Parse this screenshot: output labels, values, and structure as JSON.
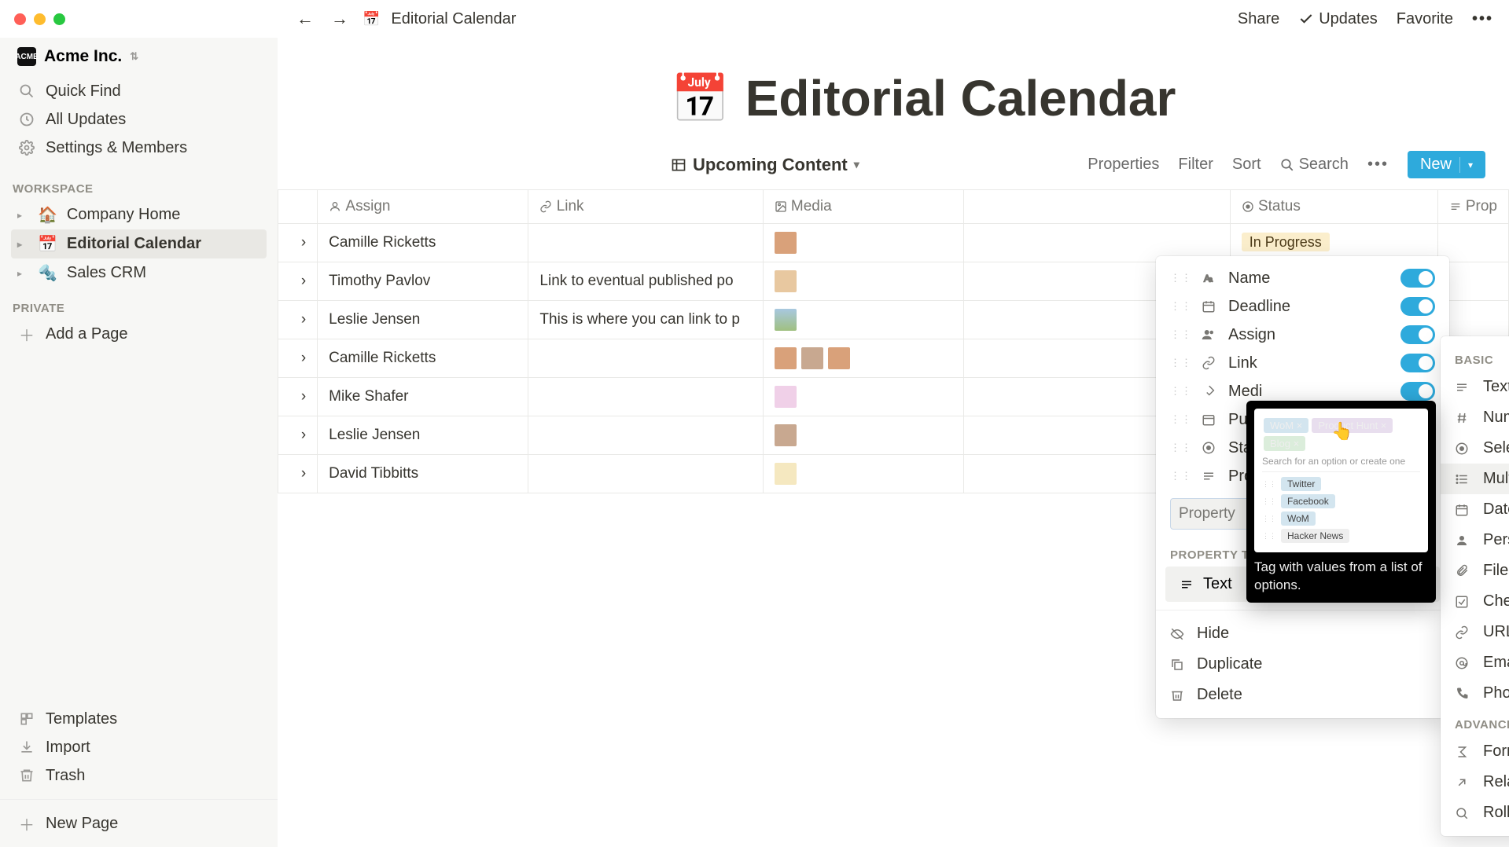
{
  "window": {
    "title": "Editorial Calendar"
  },
  "workspace": {
    "name": "Acme Inc."
  },
  "sidebar": {
    "quick_find": "Quick Find",
    "all_updates": "All Updates",
    "settings": "Settings & Members",
    "section_workspace": "WORKSPACE",
    "section_private": "PRIVATE",
    "items": [
      {
        "icon": "🏠",
        "label": "Company Home"
      },
      {
        "icon": "📅",
        "label": "Editorial Calendar"
      },
      {
        "icon": "🔩",
        "label": "Sales CRM"
      }
    ],
    "add_page": "Add a Page",
    "templates": "Templates",
    "import": "Import",
    "trash": "Trash",
    "new_page": "New Page"
  },
  "topbar": {
    "share": "Share",
    "updates": "Updates",
    "favorite": "Favorite"
  },
  "page": {
    "emoji": "📅",
    "title": "Editorial Calendar"
  },
  "database": {
    "view_name": "Upcoming Content",
    "actions": {
      "properties": "Properties",
      "filter": "Filter",
      "sort": "Sort",
      "search": "Search",
      "new": "New"
    },
    "columns": {
      "assign": "Assign",
      "link": "Link",
      "media": "Media",
      "status": "Status",
      "prop": "Prop"
    },
    "rows": [
      {
        "assign": "Camille Ricketts",
        "link": "",
        "media": 1,
        "status": "In Progress"
      },
      {
        "assign": "Timothy Pavlov",
        "link": "Link to eventual published po",
        "media": 1,
        "status": ""
      },
      {
        "assign": "Leslie Jensen",
        "link": "This is where you can link to p",
        "media": 1,
        "status": ""
      },
      {
        "assign": "Camille Ricketts",
        "link": "",
        "media": 3,
        "status": ""
      },
      {
        "assign": "Mike Shafer",
        "link": "",
        "media": 1,
        "status": ""
      },
      {
        "assign": "Leslie Jensen",
        "link": "",
        "media": 1,
        "status": ""
      },
      {
        "assign": "David Tibbitts",
        "link": "",
        "media": 1,
        "status": ""
      }
    ]
  },
  "properties_popover": {
    "items": [
      {
        "name": "Name"
      },
      {
        "name": "Deadline"
      },
      {
        "name": "Assign"
      },
      {
        "name": "Link"
      },
      {
        "name": "Medi"
      },
      {
        "name": "Publi"
      },
      {
        "name": "Statu"
      },
      {
        "name": "Prop"
      }
    ],
    "input_value": "Property",
    "section_type": "PROPERTY TYPE",
    "current_type": "Text",
    "hide": "Hide",
    "duplicate": "Duplicate",
    "delete": "Delete"
  },
  "tooltip": {
    "tags": [
      {
        "text": "WoM",
        "bg": "#d3e5ef"
      },
      {
        "text": "Product Hunt",
        "bg": "#e8deee"
      },
      {
        "text": "Blog",
        "bg": "#dbeddb"
      }
    ],
    "search_placeholder": "Search for an option or create one",
    "options": [
      {
        "text": "Twitter",
        "bg": "#d3e5ef"
      },
      {
        "text": "Facebook",
        "bg": "#d3e5ef"
      },
      {
        "text": "WoM",
        "bg": "#d3e5ef"
      },
      {
        "text": "Hacker News",
        "bg": "#eee"
      }
    ],
    "desc": "Tag with values from a list of options."
  },
  "types_popover": {
    "section_basic": "BASIC",
    "section_advanced": "ADVANCED",
    "basic": [
      "Text",
      "Number",
      "Select",
      "Multi-Select",
      "Date",
      "Person",
      "Files & Media",
      "Checkbox",
      "URL",
      "Email",
      "Phone"
    ],
    "advanced": [
      "Formula",
      "Relation",
      "Rollup"
    ],
    "hovered_index": 3
  }
}
